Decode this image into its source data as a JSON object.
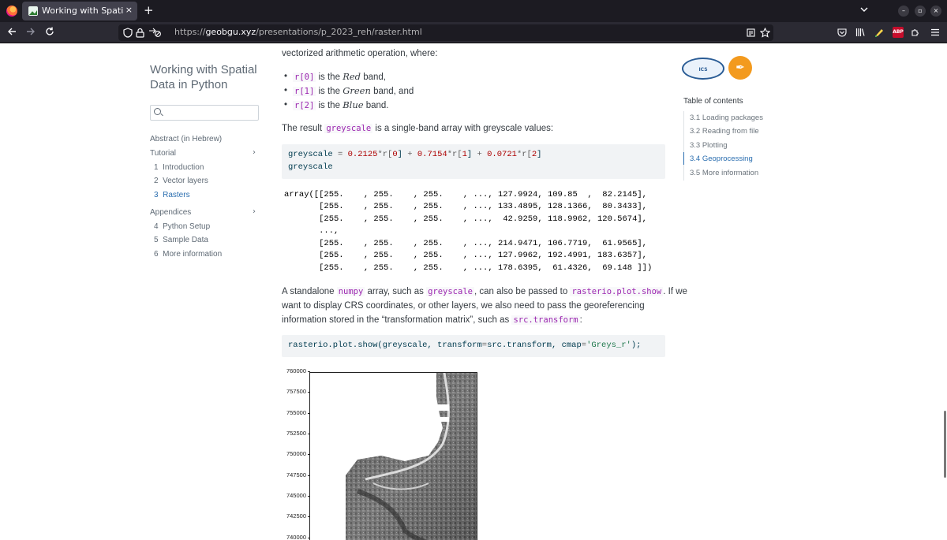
{
  "browser": {
    "tab_title": "Working with Spatial Data",
    "tab_close": "×",
    "new_tab": "+",
    "url_prefix": "https://",
    "url_host": "geobgu.xyz",
    "url_path": "/presentations/p_2023_reh/raster.html",
    "abp_label": "ABP",
    "win_min": "–",
    "win_max": "▫",
    "win_close": "×"
  },
  "sidebar": {
    "title": "Working with Spatial Data in Python",
    "search_placeholder": "",
    "abstract": "Abstract (in Hebrew)",
    "tutorial": "Tutorial",
    "tutorial_items": [
      {
        "num": "1",
        "label": "Introduction"
      },
      {
        "num": "2",
        "label": "Vector layers"
      },
      {
        "num": "3",
        "label": "Rasters"
      }
    ],
    "appendices": "Appendices",
    "appendix_items": [
      {
        "num": "4",
        "label": "Python Setup"
      },
      {
        "num": "5",
        "label": "Sample Data"
      },
      {
        "num": "6",
        "label": "More information"
      }
    ],
    "chevron": "›"
  },
  "content": {
    "intro": "vectorized arithmetic operation, where:",
    "bullets": [
      {
        "code": "r[0]",
        "pre": " is the ",
        "em": "Red",
        "post": " band,"
      },
      {
        "code": "r[1]",
        "pre": " is the ",
        "em": "Green",
        "post": " band, and"
      },
      {
        "code": "r[2]",
        "pre": " is the ",
        "em": "Blue",
        "post": " band."
      }
    ],
    "result_pre": "The result ",
    "result_code": "greyscale",
    "result_post": " is a single-band array with greyscale values:",
    "code1": {
      "var": "greyscale",
      "eq": " = ",
      "c0": "0.2125",
      "t0": "*r[",
      "i0": "0",
      "t0b": "] ",
      "plus": "+ ",
      "c1": "0.7154",
      "t1": "*r[",
      "i1": "1",
      "t1b": "] ",
      "c2": "0.0721",
      "t2": "*r[",
      "i2": "2",
      "t2b": "]",
      "line2": "greyscale"
    },
    "output_lines": [
      "array([[255.    , 255.    , 255.    , ..., 127.9924, 109.85  ,  82.2145],",
      "       [255.    , 255.    , 255.    , ..., 133.4895, 128.1366,  80.3433],",
      "       [255.    , 255.    , 255.    , ...,  42.9259, 118.9962, 120.5674],",
      "       ...,",
      "       [255.    , 255.    , 255.    , ..., 214.9471, 106.7719,  61.9565],",
      "       [255.    , 255.    , 255.    , ..., 127.9962, 192.4991, 183.6357],",
      "       [255.    , 255.    , 255.    , ..., 178.6395,  61.4326,  69.148 ]])"
    ],
    "para2_l1_a": "A standalone ",
    "para2_l1_code1": "numpy",
    "para2_l1_b": " array, such as ",
    "para2_l1_code2": "greyscale",
    "para2_l1_c": ", can also be passed to ",
    "para2_l1_code3": "rasterio.plot.show",
    "para2_l1_d": ". If we",
    "para2_l2": "want to display CRS coordinates, or other layers, we also need to pass the georeferencing",
    "para2_l3_a": "information stored in the “transformation matrix”, such as ",
    "para2_l3_code": "src.transform",
    "para2_l3_b": ":",
    "code2": {
      "a": "rasterio.plot.show(greyscale, transform",
      "eq": "=",
      "b": "src.transform, cmap",
      "eq2": "=",
      "s": "'Greys_r'",
      "c": ");"
    }
  },
  "toc": {
    "title": "Table of contents",
    "items": [
      {
        "label": "3.1 Loading packages"
      },
      {
        "label": "3.2 Reading from file"
      },
      {
        "label": "3.3 Plotting"
      },
      {
        "label": "3.4 Geoprocessing"
      },
      {
        "label": "3.5 More information"
      }
    ],
    "logo1_text": "ICS"
  },
  "plot": {
    "yticks": [
      "760000",
      "757500",
      "755000",
      "752500",
      "750000",
      "747500",
      "745000",
      "742500",
      "740000"
    ]
  }
}
